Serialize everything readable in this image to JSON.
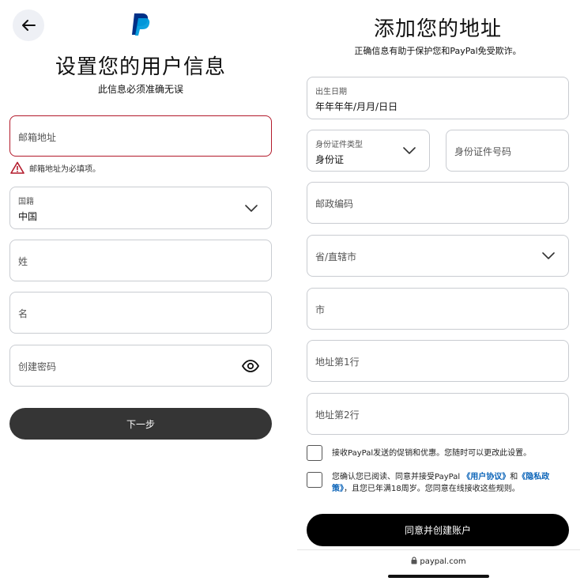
{
  "left": {
    "title": "设置您的用户信息",
    "subtitle": "此信息必须准确无误",
    "email": {
      "placeholder": "邮箱地址",
      "error": "邮箱地址为必填项。"
    },
    "nationality": {
      "label": "国籍",
      "value": "中国"
    },
    "last_name": {
      "placeholder": "姓"
    },
    "first_name": {
      "placeholder": "名"
    },
    "password": {
      "placeholder": "创建密码"
    },
    "next_label": "下一步"
  },
  "right": {
    "title": "添加您的地址",
    "subtitle": "正确信息有助于保护您和PayPal免受欺诈。",
    "dob": {
      "label": "出生日期",
      "value": "年年年年/月月/日日"
    },
    "id_type": {
      "label": "身份证件类型",
      "value": "身份证"
    },
    "id_number": {
      "placeholder": "身份证件号码"
    },
    "postal": {
      "placeholder": "邮政编码"
    },
    "province": {
      "placeholder": "省/直辖市"
    },
    "city": {
      "placeholder": "市"
    },
    "address1": {
      "placeholder": "地址第1行"
    },
    "address2": {
      "placeholder": "地址第2行"
    },
    "marketing_consent": "接收PayPal发送的促销和优惠。您随时可以更改此设置。",
    "agreement": {
      "prefix": "您确认您已阅读、同意并接受PayPal ",
      "user_agreement": "《用户协议》",
      "and": "和",
      "privacy": "《隐私政策》",
      "suffix": "，且您已年满18周岁。您同意在线接收这些规则。"
    },
    "submit_label": "同意并创建账户",
    "url": "paypal.com"
  },
  "colors": {
    "error": "#b31a2b",
    "link": "#0a63b8",
    "button_dark": "#353535",
    "button_black": "#000000",
    "paypal_dark": "#003087",
    "paypal_light": "#009cde"
  }
}
